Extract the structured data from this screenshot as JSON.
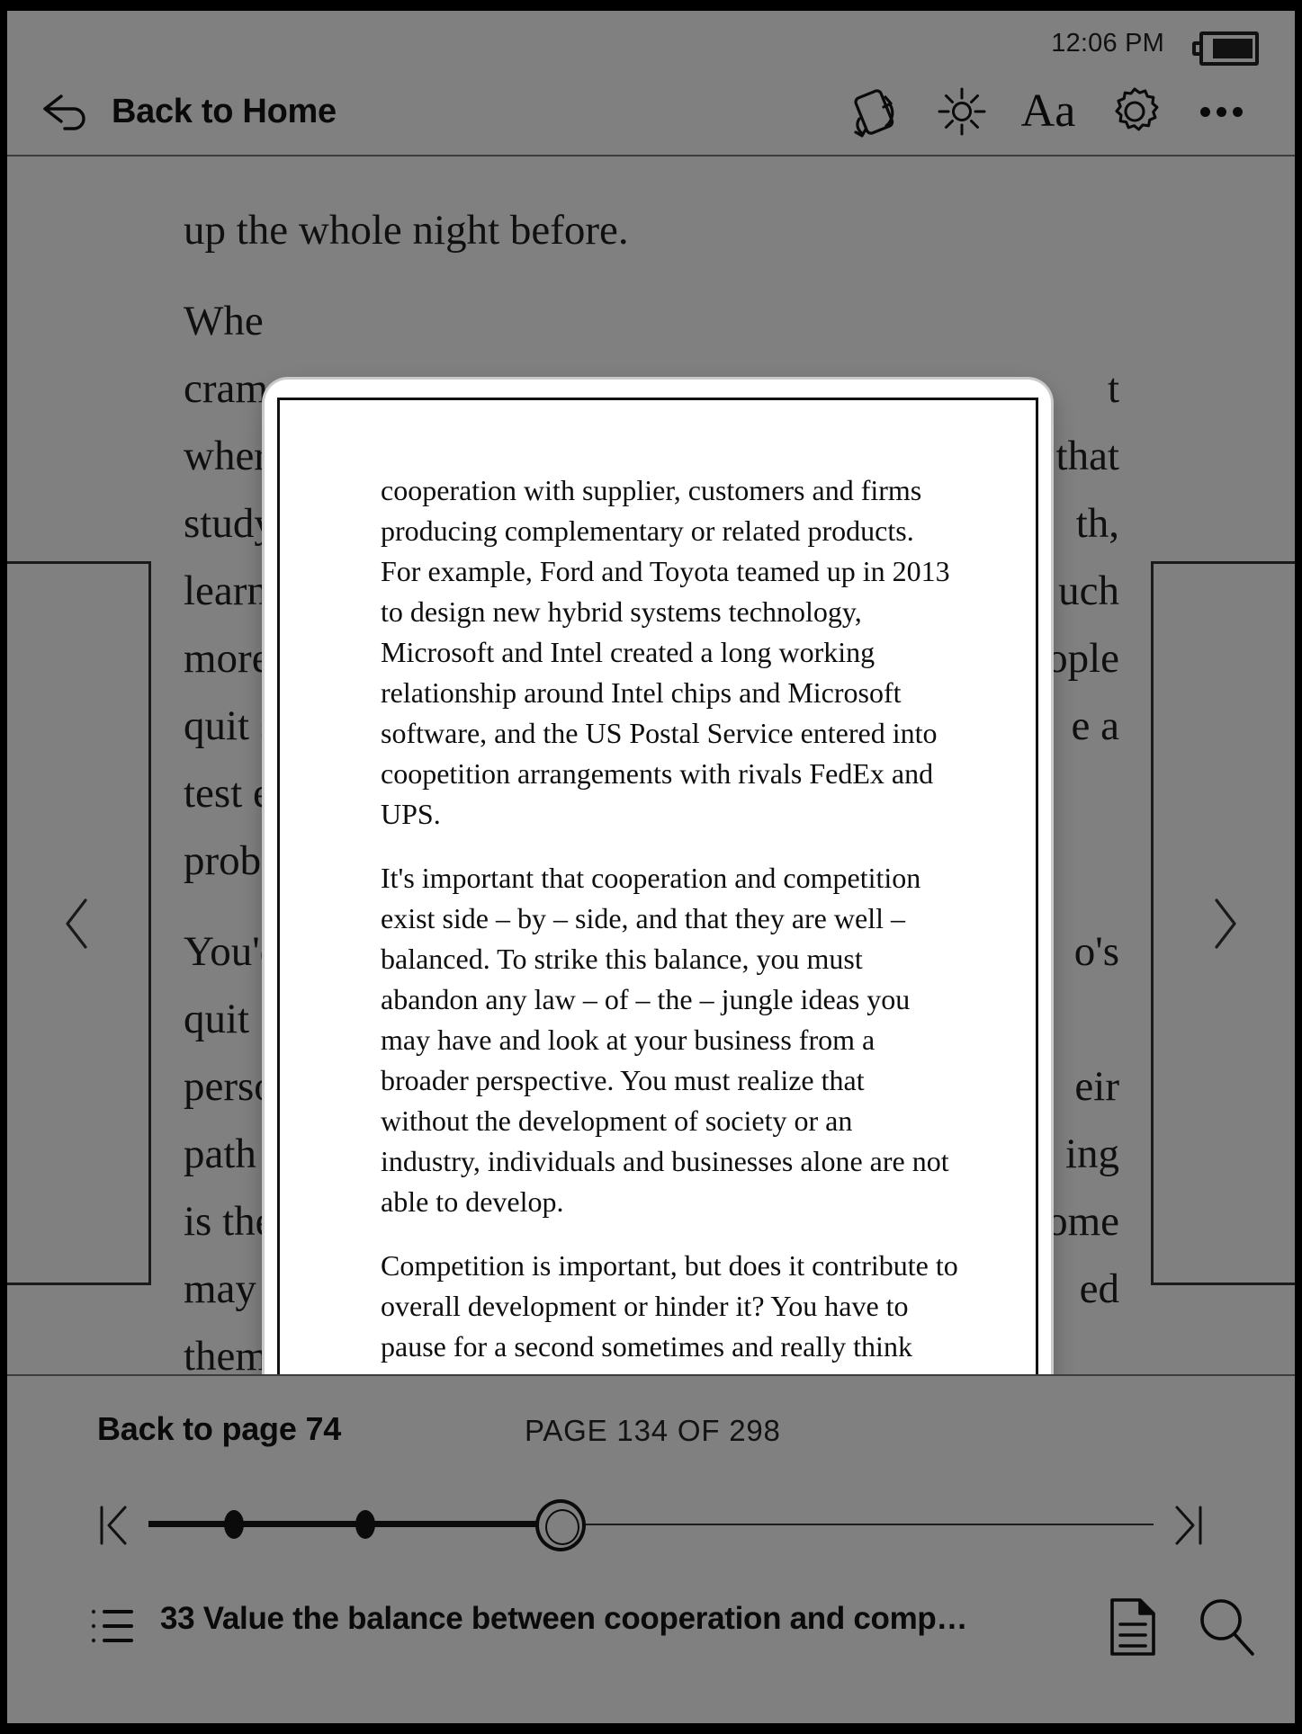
{
  "status": {
    "time": "12:06 PM",
    "battery_icon": "battery-icon"
  },
  "toolbar": {
    "back_label": "Back to Home",
    "back_icon": "back-arrow-icon",
    "icons": [
      {
        "name": "rotate-screen-icon",
        "label": "Rotate screen"
      },
      {
        "name": "brightness-icon",
        "label": "Brightness"
      },
      {
        "name": "font-size-icon",
        "label": "Aa"
      },
      {
        "name": "settings-gear-icon",
        "label": "Settings"
      },
      {
        "name": "more-options-icon",
        "label": "More"
      }
    ],
    "aa_label": "Aa"
  },
  "page_content": {
    "lines": [
      "up the whole night before.",
      "Whe",
      "cram",
      "wher",
      "study",
      "learn",
      "more",
      "quit s",
      "test e",
      "prob",
      "You'd",
      "quit",
      "perso",
      "path",
      "is the",
      "may",
      "them at all in their working lives. But the reason it"
    ],
    "right_fragments": [
      "t",
      "that",
      "th,",
      "uch",
      "ople",
      "e a",
      "o's",
      "eir",
      "ing",
      "ome",
      "ed"
    ],
    "visible_full_first": "up the whole night before.",
    "visible_full_last": "them at all in their working lives. But the reason it"
  },
  "popup": {
    "paragraphs": [
      "cooperation with supplier, customers and firms producing complementary or related products. For example, Ford and Toyota teamed up in 2013 to design new hybrid systems technology, Microsoft and Intel created a long working relationship around Intel chips and Microsoft software, and the US Postal Service entered into coopetition arrangements with rivals FedEx and UPS.",
      "It's important that cooperation and competition exist side – by – side, and that they are well – balanced. To strike this balance, you must abandon any law – of – the – jungle ideas you may have and look at your business from a broader perspective. You must realize that without the development of society or an industry, individuals and businesses alone are not able to develop.",
      "Competition is important, but does it contribute to overall development or hinder it? You have to pause for a second sometimes and really think about this. Should you be competing or cooperating? Swallow your pride and think about it objectively from a third"
    ]
  },
  "navigation": {
    "prev_icon": "chevron-left-icon",
    "next_icon": "chevron-right-icon"
  },
  "bottom": {
    "back_to_page": "Back to page 74",
    "page_indicator": "PAGE 134 OF 298",
    "slider": {
      "jump_start_icon": "jump-to-start-icon",
      "jump_end_icon": "jump-to-end-icon",
      "thumb_icon": "slider-thumb",
      "progress_percent": 45,
      "bookmarks": [
        11,
        23
      ]
    },
    "toc_title": "33 Value the balance between cooperation and comp…",
    "toc_icon": "table-of-contents-icon",
    "notes_icon": "notes-document-icon",
    "search_icon": "search-icon"
  },
  "colors": {
    "screen_bg": "#808080",
    "popup_bg": "#ffffff",
    "ink": "#0a0a0a",
    "bezel": "#000000"
  }
}
